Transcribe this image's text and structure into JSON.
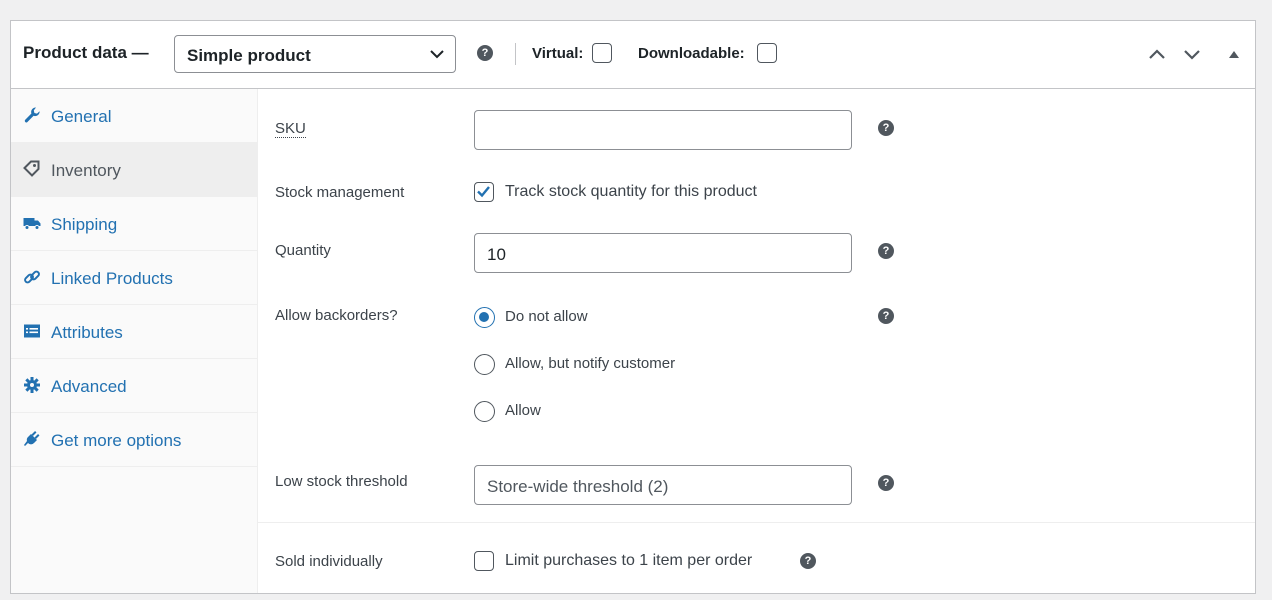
{
  "header": {
    "title": "Product data —",
    "product_type": "Simple product",
    "virtual_label": "Virtual:",
    "downloadable_label": "Downloadable:",
    "virtual_checked": false,
    "downloadable_checked": false
  },
  "sidebar": {
    "items": [
      {
        "label": "General",
        "icon": "wrench-icon",
        "active": false
      },
      {
        "label": "Inventory",
        "icon": "tag-icon",
        "active": true
      },
      {
        "label": "Shipping",
        "icon": "truck-icon",
        "active": false
      },
      {
        "label": "Linked Products",
        "icon": "link-icon",
        "active": false
      },
      {
        "label": "Attributes",
        "icon": "list-icon",
        "active": false
      },
      {
        "label": "Advanced",
        "icon": "gear-icon",
        "active": false
      },
      {
        "label": "Get more options",
        "icon": "plug-icon",
        "active": false
      }
    ]
  },
  "fields": {
    "sku": {
      "label": "SKU",
      "value": ""
    },
    "stock_management": {
      "label": "Stock management",
      "checkbox_label": "Track stock quantity for this product",
      "checked": true
    },
    "quantity": {
      "label": "Quantity",
      "value": "10"
    },
    "backorders": {
      "label": "Allow backorders?",
      "options": [
        "Do not allow",
        "Allow, but notify customer",
        "Allow"
      ],
      "selected": "Do not allow"
    },
    "low_stock": {
      "label": "Low stock threshold",
      "placeholder": "Store-wide threshold (2)"
    },
    "sold_individually": {
      "label": "Sold individually",
      "checkbox_label": "Limit purchases to 1 item per order",
      "checked": false
    }
  },
  "colors": {
    "accent": "#2271b1",
    "text": "#1d2327",
    "muted": "#50575e"
  },
  "help_glyph": "?"
}
